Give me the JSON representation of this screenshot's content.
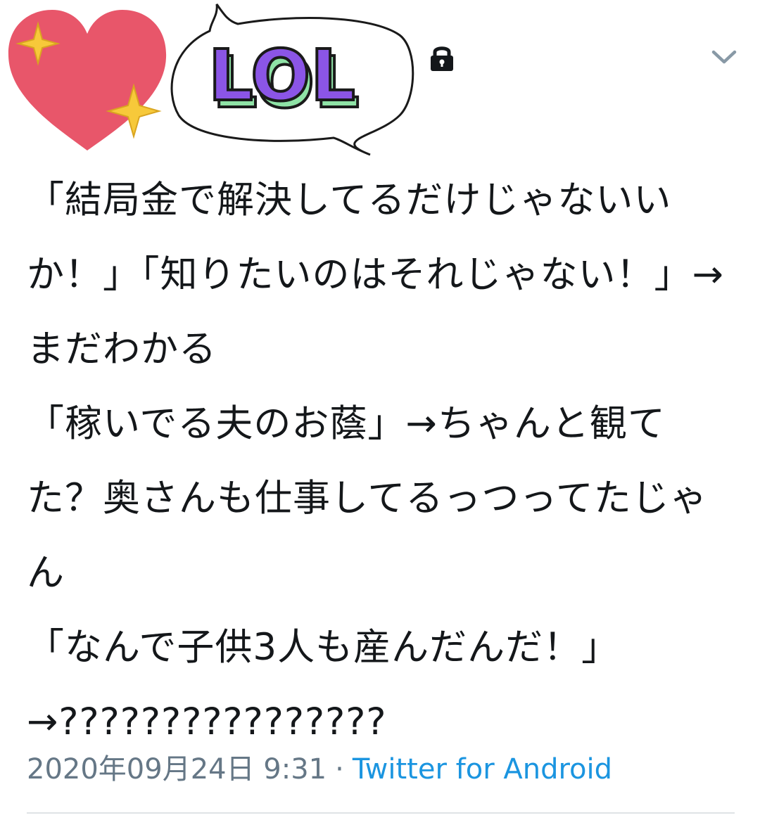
{
  "tweet": {
    "text": "「結局金で解決してるだけじゃないいか！」「知りたいのはそれじゃない！」→まだわかる\n「稼いでる夫のお蔭」→ちゃんと観てた？奥さんも仕事してるっつってたじゃん\n「なんで子供3人も産んだんだ！」→????????????????",
    "date": "2020年09月24日 9:31",
    "separator": "·",
    "client": "Twitter for Android"
  },
  "stickers": {
    "lol_text": "LOL",
    "heart": "sparkling-heart-sticker",
    "speech": "lol-speech-bubble-sticker"
  },
  "icons": {
    "lock": "lock-icon",
    "chevron": "chevron-down-icon"
  },
  "colors": {
    "text": "#14171a",
    "muted": "#657786",
    "link": "#1b95e0",
    "heart": "#e8566a",
    "sparkle": "#f7c93a",
    "lol_fill": "#8b55e6",
    "lol_shadow": "#8fe3a6"
  }
}
